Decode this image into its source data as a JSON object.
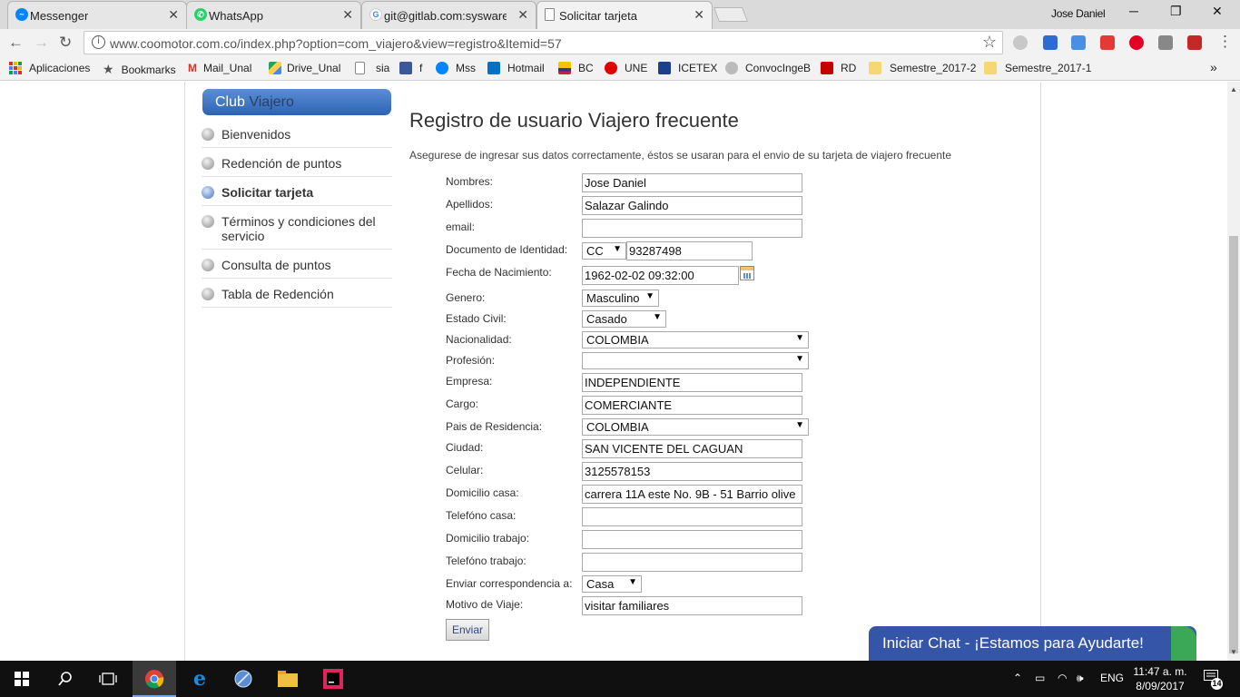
{
  "browser": {
    "tabs": [
      {
        "label": "Messenger",
        "icon": "messenger-icon"
      },
      {
        "label": "WhatsApp",
        "icon": "whatsapp-icon"
      },
      {
        "label": "git@gitlab.com:sysware-",
        "icon": "google-icon"
      },
      {
        "label": "Solicitar tarjeta",
        "icon": "page-icon"
      }
    ],
    "user_name": "Jose Daniel",
    "url": "www.coomotor.com.co/index.php?option=com_viajero&view=registro&Itemid=57"
  },
  "bookmarks": [
    {
      "label": "Aplicaciones",
      "color": "#d93025"
    },
    {
      "label": "Bookmarks",
      "color": "#555555"
    },
    {
      "label": "Mail_Unal",
      "color": "#d93025"
    },
    {
      "label": "Drive_Unal",
      "color": "#1fa463"
    },
    {
      "label": "sia",
      "color": "#888888"
    },
    {
      "label": "f",
      "color": "#3b5998"
    },
    {
      "label": "Mss",
      "color": "#0084ff"
    },
    {
      "label": "Hotmail",
      "color": "#0072c6"
    },
    {
      "label": "BC",
      "color": "#f4c400"
    },
    {
      "label": "UNE",
      "color": "#e00000"
    },
    {
      "label": "ICETEX",
      "color": "#1c3f8c"
    },
    {
      "label": "ConvocIngeB",
      "color": "#999999"
    },
    {
      "label": "RD",
      "color": "#c40000"
    },
    {
      "label": "Semestre_2017-2",
      "color": "#f7d774"
    },
    {
      "label": "Semestre_2017-1",
      "color": "#f7d774"
    }
  ],
  "sidebar": {
    "title_a": "Club",
    "title_b": "Viajero",
    "items": [
      {
        "label": "Bienvenidos"
      },
      {
        "label": "Redención de puntos"
      },
      {
        "label": "Solicitar tarjeta"
      },
      {
        "label": "Términos y condiciones del servicio"
      },
      {
        "label": "Consulta de puntos"
      },
      {
        "label": "Tabla de Redención"
      }
    ]
  },
  "main": {
    "title": "Registro de usuario Viajero frecuente",
    "intro": "Asegurese de ingresar sus datos correctamente, éstos se usaran para el envio de su tarjeta de viajero frecuente",
    "submit_label": "Enviar"
  },
  "form": {
    "nombres": {
      "label": "Nombres:",
      "value": "Jose Daniel"
    },
    "apellidos": {
      "label": "Apellidos:",
      "value": "Salazar Galindo"
    },
    "email": {
      "label": "email:",
      "value": ""
    },
    "documento": {
      "label": "Documento de Identidad:",
      "type": "CC",
      "value": "93287498"
    },
    "fecha": {
      "label": "Fecha de Nacimiento:",
      "value": "1962-02-02 09:32:00"
    },
    "genero": {
      "label": "Genero:",
      "value": "Masculino"
    },
    "estado_civil": {
      "label": "Estado Civil:",
      "value": "Casado"
    },
    "nacionalidad": {
      "label": "Nacionalidad:",
      "value": "COLOMBIA"
    },
    "profesion": {
      "label": "Profesión:",
      "value": ""
    },
    "empresa": {
      "label": "Empresa:",
      "value": "INDEPENDIENTE"
    },
    "cargo": {
      "label": "Cargo:",
      "value": "COMERCIANTE"
    },
    "pais_residencia": {
      "label": "Pais de Residencia:",
      "value": "COLOMBIA"
    },
    "ciudad": {
      "label": "Ciudad:",
      "value": "SAN VICENTE DEL CAGUAN"
    },
    "celular": {
      "label": "Celular:",
      "value": "3125578153"
    },
    "domicilio_casa": {
      "label": "Domicilio casa:",
      "value": "carrera 11A este No. 9B - 51 Barrio olive"
    },
    "telefono_casa": {
      "label": "Telefóno casa:",
      "value": ""
    },
    "domicilio_trabajo": {
      "label": "Domicilio trabajo:",
      "value": ""
    },
    "telefono_trabajo": {
      "label": "Telefóno trabajo:",
      "value": ""
    },
    "correspondencia": {
      "label": "Enviar correspondencia a:",
      "value": "Casa"
    },
    "motivo": {
      "label": "Motivo de Viaje:",
      "value": "visitar familiares"
    }
  },
  "chat": {
    "label": "Iniciar Chat - ¡Estamos para Ayudarte!"
  },
  "taskbar": {
    "language": "ENG",
    "time": "11:47 a. m.",
    "date": "8/09/2017",
    "notifications": "14"
  }
}
